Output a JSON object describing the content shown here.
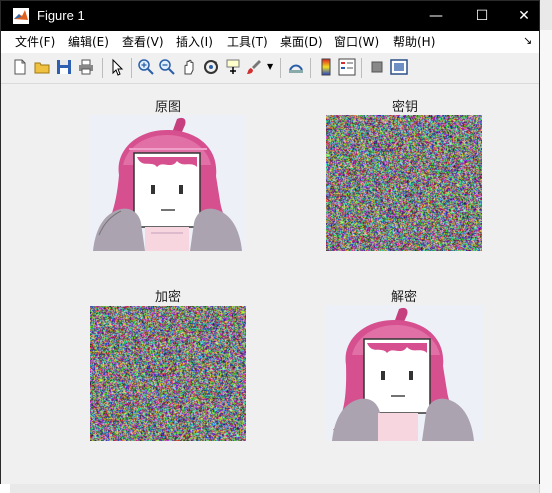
{
  "window": {
    "title": "Figure 1",
    "controls": {
      "minimize": "—",
      "maximize": "☐",
      "close": "✕"
    }
  },
  "menu": {
    "items": [
      "文件(F)",
      "编辑(E)",
      "查看(V)",
      "插入(I)",
      "工具(T)",
      "桌面(D)",
      "窗口(W)",
      "帮助(H)"
    ],
    "dock_glyph": "↘"
  },
  "toolbar": {
    "icons": [
      "new-figure-icon",
      "open-file-icon",
      "save-icon",
      "print-icon",
      "pointer-icon",
      "zoom-in-icon",
      "zoom-out-icon",
      "pan-icon",
      "rotate-3d-icon",
      "data-cursor-icon",
      "brush-icon",
      "link-plot-icon",
      "colorbar-icon",
      "legend-icon",
      "hide-plot-tools-icon",
      "show-plot-tools-icon"
    ]
  },
  "subplots": [
    {
      "title": "原图",
      "image": "original-character-image"
    },
    {
      "title": "密钥",
      "image": "key-noise-image"
    },
    {
      "title": "加密",
      "image": "encrypted-noise-image"
    },
    {
      "title": "解密",
      "image": "decrypted-character-image"
    }
  ],
  "colors": {
    "titlebar": "#000000",
    "hair_pink": "#d2508f",
    "hair_dark": "#a8306f",
    "shoulder_gray": "#a9a3ad",
    "background": "#f0f0f0"
  }
}
